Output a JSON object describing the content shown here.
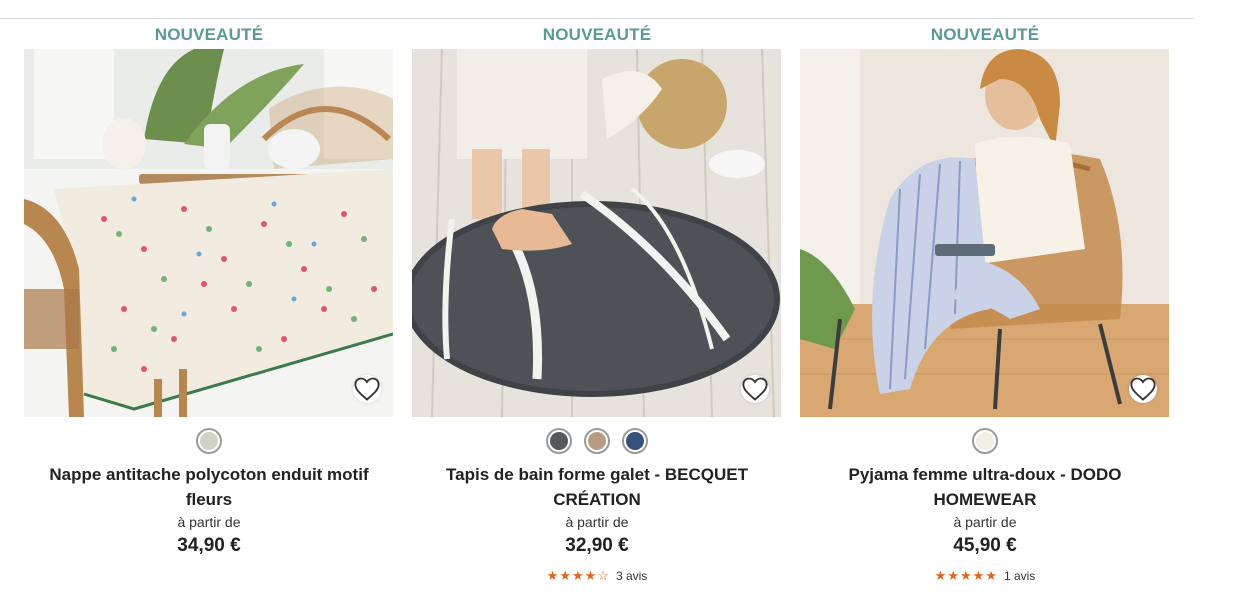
{
  "products": [
    {
      "badge": "NOUVEAUTÉ",
      "title_line1": "Nappe antitache polycoton enduit motif fleurs",
      "title_line2": "",
      "price_prefix": "à partir de",
      "price": "34,90 €",
      "swatches": [
        "#cfd3c4"
      ],
      "stars": "",
      "reviews": ""
    },
    {
      "badge": "NOUVEAUTÉ",
      "title_line1": "Tapis de bain forme galet - BECQUET",
      "title_line2": "CRÉATION",
      "price_prefix": "à partir de",
      "price": "32,90 €",
      "swatches": [
        "#55585c",
        "#b79c83",
        "#35507a"
      ],
      "stars": "★★★★☆",
      "reviews": "3 avis"
    },
    {
      "badge": "NOUVEAUTÉ",
      "title_line1": "Pyjama femme ultra-doux - DODO",
      "title_line2": "HOMEWEAR",
      "price_prefix": "à partir de",
      "price": "45,90 €",
      "swatches": [
        "#f2efe6"
      ],
      "stars": "★★★★★",
      "reviews": "1 avis"
    }
  ]
}
